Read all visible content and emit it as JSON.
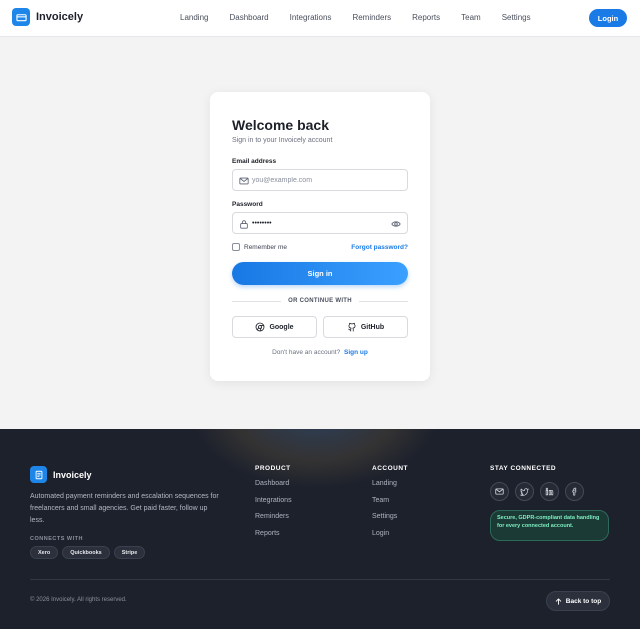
{
  "brand": {
    "name": "Invoicely",
    "color": "#1e86e8"
  },
  "nav": {
    "items": [
      "Landing",
      "Dashboard",
      "Integrations",
      "Reminders",
      "Reports",
      "Team",
      "Settings"
    ],
    "login_label": "Login"
  },
  "login_card": {
    "title": "Welcome back",
    "subtitle": "Sign in to your Invoicely account",
    "email_label": "Email address",
    "email_placeholder": "you@example.com",
    "password_label": "Password",
    "password_value": "••••••••",
    "remember_label": "Remember me",
    "forgot_label": "Forgot password?",
    "signin_label": "Sign in",
    "divider_label": "OR CONTINUE WITH",
    "google_label": "Google",
    "github_label": "GitHub",
    "signup_prompt": "Don't have an account?",
    "signup_link": "Sign up"
  },
  "footer": {
    "brand_name": "Invoicely",
    "description": "Automated payment reminders and escalation sequences for freelancers and small agencies. Get paid faster, follow up less.",
    "connects_label": "CONNECTS WITH",
    "integrations": [
      "Xero",
      "Quickbooks",
      "Stripe"
    ],
    "product": {
      "title": "PRODUCT",
      "links": [
        "Dashboard",
        "Integrations",
        "Reminders",
        "Reports"
      ]
    },
    "account": {
      "title": "ACCOUNT",
      "links": [
        "Landing",
        "Team",
        "Settings",
        "Login"
      ]
    },
    "connected": {
      "title": "STAY CONNECTED",
      "icons": [
        "mail-icon",
        "twitter-icon",
        "linkedin-icon",
        "facebook-icon"
      ]
    },
    "gdpr_note": "Secure, GDPR-compliant data handling for every connected account.",
    "copyright": "© 2026 Invoicely. All rights reserved.",
    "back_to_top": "Back to top"
  }
}
